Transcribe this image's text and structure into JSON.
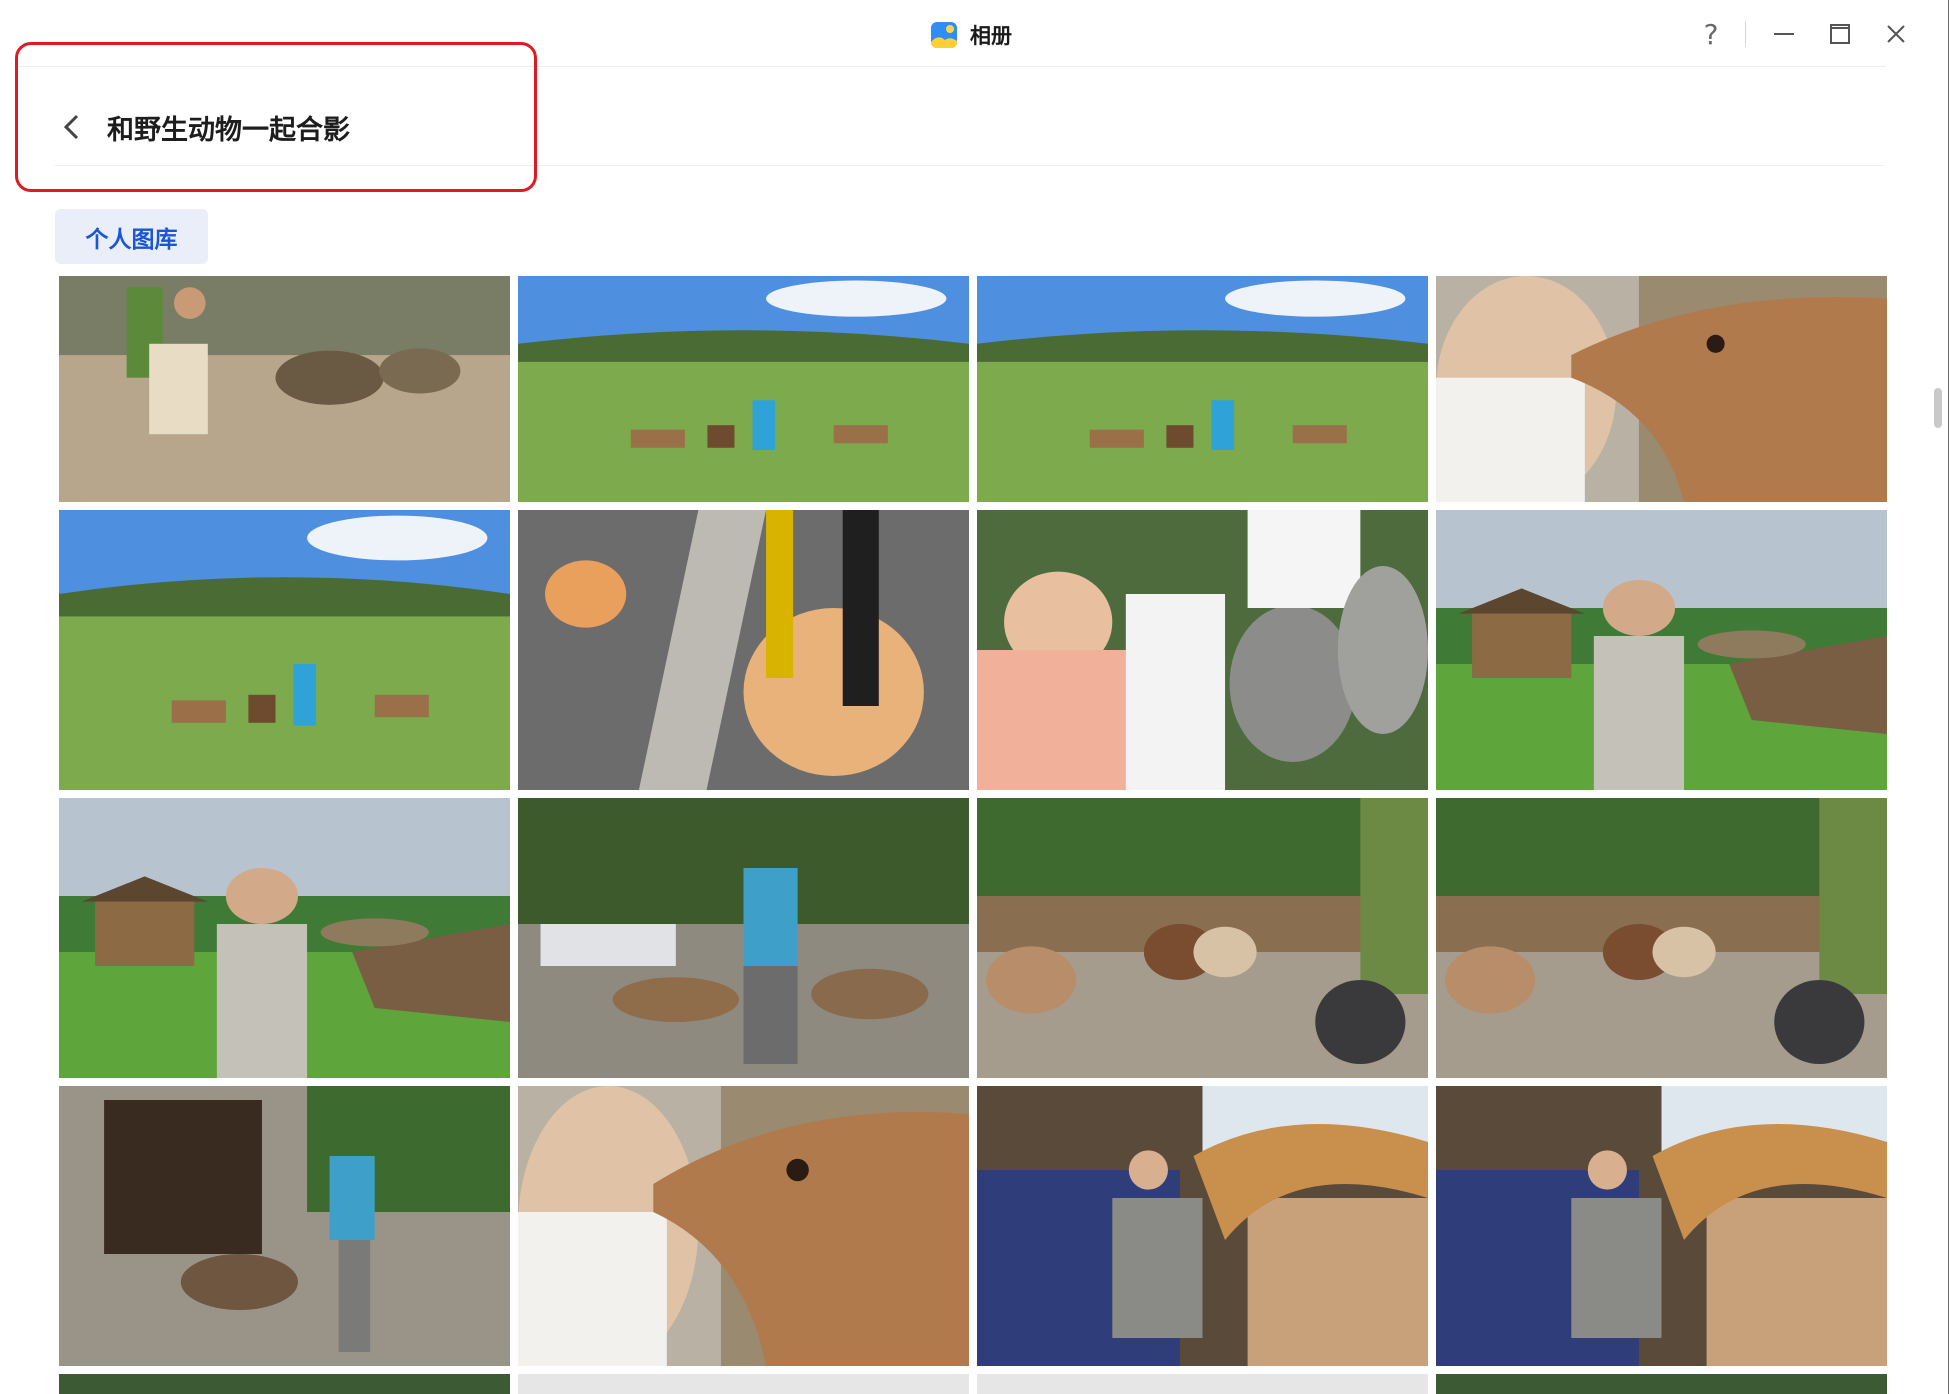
{
  "window": {
    "app_title": "相册",
    "controls": [
      "?",
      "minimize",
      "maximize",
      "close"
    ]
  },
  "album": {
    "title": "和野生动物一起合影",
    "source_tag": "个人图库"
  },
  "photos": [
    {
      "name": "tortoise-feeding",
      "scene": "sand",
      "sky": false
    },
    {
      "name": "deer-field-1",
      "scene": "field",
      "sky": true
    },
    {
      "name": "deer-field-2",
      "scene": "field",
      "sky": true
    },
    {
      "name": "deer-selfie-1",
      "scene": "selfie",
      "sky": false
    },
    {
      "name": "deer-field-3",
      "scene": "field",
      "sky": true
    },
    {
      "name": "cats-path",
      "scene": "cats",
      "sky": false
    },
    {
      "name": "lemurs-crowd",
      "scene": "crowd",
      "sky": false
    },
    {
      "name": "lemur-hut-1",
      "scene": "hut",
      "sky": true
    },
    {
      "name": "lemur-hut-2",
      "scene": "hut",
      "sky": true
    },
    {
      "name": "deer-park-students",
      "scene": "park",
      "sky": false
    },
    {
      "name": "alpacas-1",
      "scene": "alpaca",
      "sky": false
    },
    {
      "name": "alpacas-2",
      "scene": "alpaca",
      "sky": false
    },
    {
      "name": "deer-shrine",
      "scene": "shrine",
      "sky": false
    },
    {
      "name": "deer-selfie-2",
      "scene": "selfie",
      "sky": false
    },
    {
      "name": "giraffe-feeding-1",
      "scene": "giraffe",
      "sky": true
    },
    {
      "name": "giraffe-feeding-2",
      "scene": "giraffe",
      "sky": true
    }
  ],
  "colors": {
    "accent": "#1a56d6",
    "highlight": "#e01a22",
    "tag_bg": "#e9eef8"
  }
}
